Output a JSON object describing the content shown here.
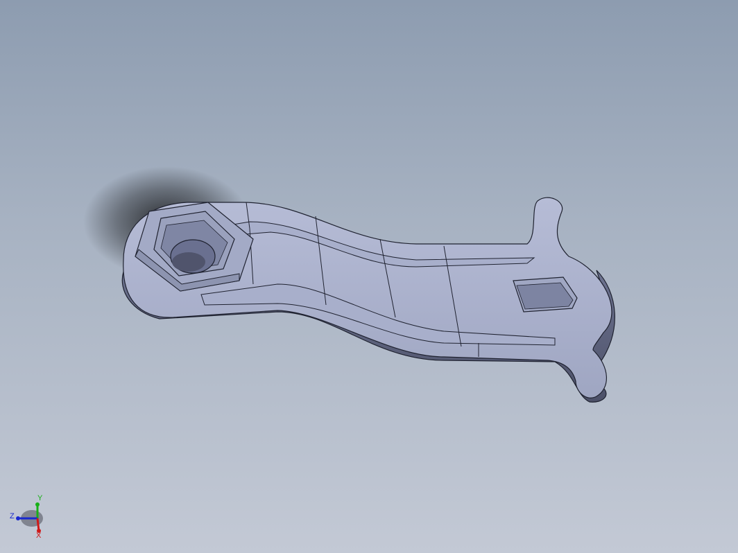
{
  "viewport": {
    "background_top": "#8d9cb0",
    "background_bottom": "#c3c9d5"
  },
  "model": {
    "part_color": "#a7aeca",
    "edge_color": "#1f2230"
  },
  "triad": {
    "labels": {
      "y": "Y",
      "z": "Z",
      "x": "X"
    },
    "colors": {
      "x": "#d01818",
      "y": "#18b018",
      "z": "#1828d0"
    }
  }
}
